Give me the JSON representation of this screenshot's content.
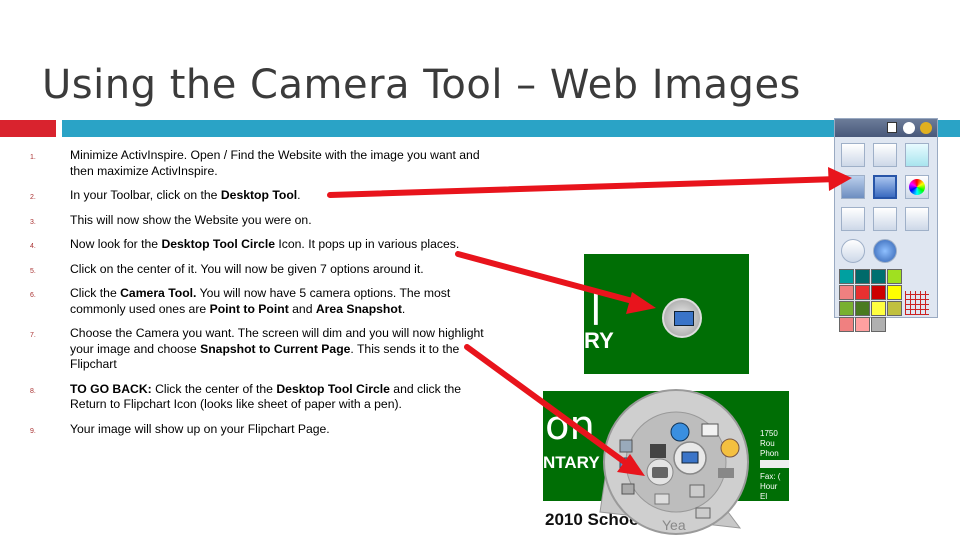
{
  "slide": {
    "title": "Using the Camera Tool – Web Images"
  },
  "steps": [
    {
      "num": "1.",
      "segments": [
        {
          "text": "Minimize ActivInspire. Open / Find the Website with the image you want and then maximize ActivInspire.",
          "bold": false
        }
      ]
    },
    {
      "num": "2.",
      "segments": [
        {
          "text": "In your Toolbar, click on the ",
          "bold": false
        },
        {
          "text": "Desktop Tool",
          "bold": true
        },
        {
          "text": ".",
          "bold": false
        }
      ]
    },
    {
      "num": "3.",
      "segments": [
        {
          "text": "This will now show the Website you were on.",
          "bold": false
        }
      ]
    },
    {
      "num": "4.",
      "segments": [
        {
          "text": "Now look for the ",
          "bold": false
        },
        {
          "text": "Desktop Tool Circle",
          "bold": true
        },
        {
          "text": " Icon.  It pops up in various places.",
          "bold": false
        }
      ]
    },
    {
      "num": "5.",
      "segments": [
        {
          "text": "Click on the center of it.  You will now be given 7 options around it.",
          "bold": false
        }
      ]
    },
    {
      "num": "6.",
      "segments": [
        {
          "text": "Click the ",
          "bold": false
        },
        {
          "text": "Camera Tool.",
          "bold": true
        },
        {
          "text": "  You will now have 5 camera options.  The most commonly used ones are ",
          "bold": false
        },
        {
          "text": "Point to Point",
          "bold": true
        },
        {
          "text": " and ",
          "bold": false
        },
        {
          "text": "Area Snapshot",
          "bold": true
        },
        {
          "text": ".",
          "bold": false
        }
      ]
    },
    {
      "num": "7.",
      "segments": [
        {
          "text": "Choose the Camera you want.  The screen will dim and you will now highlight your image and choose ",
          "bold": false
        },
        {
          "text": "Snapshot to Current Page",
          "bold": true
        },
        {
          "text": ".  This sends it to the Flipchart",
          "bold": false
        }
      ]
    },
    {
      "num": "8.",
      "segments": [
        {
          "text": "TO GO BACK:",
          "bold": true
        },
        {
          "text": "  Click the center of the ",
          "bold": false
        },
        {
          "text": "Desktop Tool Circle",
          "bold": true
        },
        {
          "text": " and click the Return to Flipchart Icon (looks like sheet of paper with a pen).",
          "bold": false
        }
      ]
    },
    {
      "num": "9.",
      "segments": [
        {
          "text": "Your image will show up on your Flipchart Page.",
          "bold": false
        }
      ]
    }
  ],
  "screenshot_top": {
    "text_partial_1": "l",
    "text_partial_2": "RY"
  },
  "screenshot_bottom": {
    "text_on": "on",
    "text_ntary": "NTARY",
    "text_school": "2010 School",
    "text_year": "Yea",
    "side_text_1": "1750",
    "side_text_2": "Rou",
    "side_text_3": "Phon",
    "side_text_4": "Fax: (",
    "side_text_5": "Hour",
    "side_text_6": "El"
  },
  "toolbar_swatches": [
    "#00a0a0",
    "#006a6a",
    "#007070",
    "#a0e020",
    "#f08080",
    "#e83030",
    "#cc0000",
    "#ffff00",
    "#78b030",
    "#4a7a20",
    "#ffff40",
    "#c0c040",
    "#f08080",
    "#ffa0a0",
    "#b0b0b0"
  ],
  "arrow_color": "#e8141c",
  "theme": {
    "red": "#d9232e",
    "blue": "#2aa3c6",
    "green": "#006e05"
  }
}
